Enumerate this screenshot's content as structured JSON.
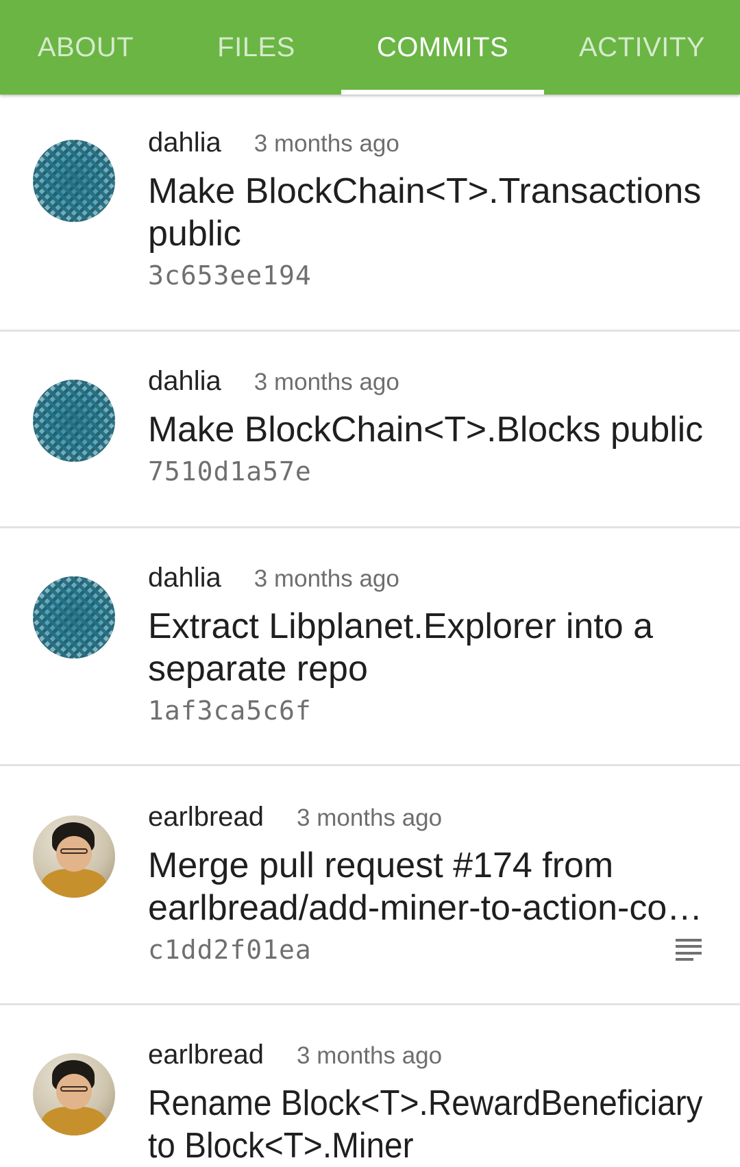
{
  "tabs": [
    {
      "label": "ABOUT",
      "active": false
    },
    {
      "label": "FILES",
      "active": false
    },
    {
      "label": "COMMITS",
      "active": true
    },
    {
      "label": "ACTIVITY",
      "active": false
    }
  ],
  "commits": [
    {
      "author": "dahlia",
      "time": "3 months ago",
      "title_line1": "Make BlockChain<T>.Transactions",
      "title_line2": "public",
      "sha": "3c653ee194",
      "avatar": "pattern-avatar"
    },
    {
      "author": "dahlia",
      "time": "3 months ago",
      "title_line1": "Make BlockChain<T>.Blocks public",
      "title_line2": "",
      "sha": "7510d1a57e",
      "avatar": "pattern-avatar"
    },
    {
      "author": "dahlia",
      "time": "3 months ago",
      "title_line1": "Extract Libplanet.Explorer into a",
      "title_line2": "separate repo",
      "sha": "1af3ca5c6f",
      "avatar": "pattern-avatar"
    },
    {
      "author": "earlbread",
      "time": "3 months ago",
      "title_line1": "Merge pull request #174 from",
      "title_line2": "earlbread/add-miner-to-action-co…",
      "sha": "c1dd2f01ea",
      "avatar": "person-avatar",
      "has_description": true
    },
    {
      "author": "earlbread",
      "time": "3 months ago",
      "title_line1": "Rename Block<T>.RewardBeneficiary",
      "title_line2": "to Block<T>.Miner",
      "sha": "",
      "avatar": "person-avatar"
    }
  ],
  "colors": {
    "accent": "#6ab544"
  },
  "icons": {
    "description": "notes-icon"
  }
}
